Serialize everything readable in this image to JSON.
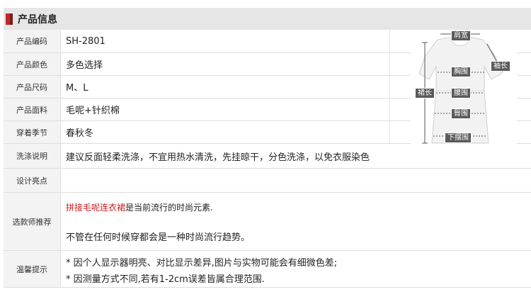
{
  "header": {
    "title": "产品信息"
  },
  "rows": [
    {
      "label": "产品编码",
      "value": "SH-2801"
    },
    {
      "label": "产品颜色",
      "value": "多色选择"
    },
    {
      "label": "产品尺码",
      "value": "M、L"
    },
    {
      "label": "产品面料",
      "value": "毛呢+针织棉"
    },
    {
      "label": "穿着季节",
      "value": "春秋冬"
    },
    {
      "label": "洗涤说明",
      "value": "建议反面轻柔洗涤，不宜用热水清洗，先挂晾干，分色洗涤，以免衣服染色"
    },
    {
      "label": "设计亮点",
      "value": ""
    }
  ],
  "recommend": {
    "label": "选款师推荐",
    "highlight": "拼接毛呢连衣裙",
    "line1_rest": "是当前流行的时尚元素.",
    "line2": "不管在任何时候穿都会是一种时尚流行趋势。"
  },
  "notice": {
    "label": "温馨提示",
    "line1": "* 因个人显示器明亮、对比显示差异,图片与实物可能会有细微色差;",
    "line2": "* 因测量方式不同,若有1-2cm误差皆属合理范围."
  },
  "figure": {
    "shoulder": "肩宽",
    "sleeve": "袖长",
    "chest": "胸围",
    "length": "裙长",
    "waist": "腰围",
    "hip": "臀围",
    "hem": "下摆围"
  }
}
